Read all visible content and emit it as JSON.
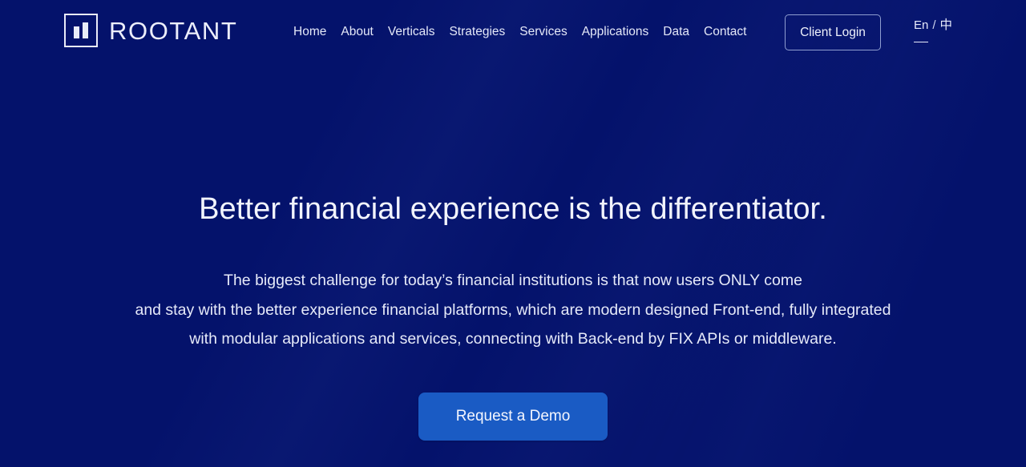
{
  "theme": {
    "background_navy": "#04126b",
    "text_light": "#eceefb",
    "cta_blue": "#1a5bc4",
    "login_border": "#8f9ed0"
  },
  "header": {
    "brand": {
      "logo_icon": "rootant-bars-square-icon",
      "name": "ROOTANT"
    },
    "nav": [
      {
        "label": "Home"
      },
      {
        "label": "About"
      },
      {
        "label": "Verticals"
      },
      {
        "label": "Strategies"
      },
      {
        "label": "Services"
      },
      {
        "label": "Applications"
      },
      {
        "label": "Data"
      },
      {
        "label": "Contact"
      }
    ],
    "login_label": "Client Login",
    "language": {
      "active": "En",
      "separator": "/",
      "alternate": "中"
    }
  },
  "hero": {
    "title": "Better financial experience is the differentiator.",
    "subtitle_lines": [
      "The biggest challenge for today’s financial institutions is that now users ONLY come",
      "and stay with the better experience financial platforms, which are modern designed Front-end, fully integrated",
      "with modular applications and services, connecting with Back-end by FIX APIs or middleware."
    ],
    "cta_label": "Request a Demo"
  }
}
